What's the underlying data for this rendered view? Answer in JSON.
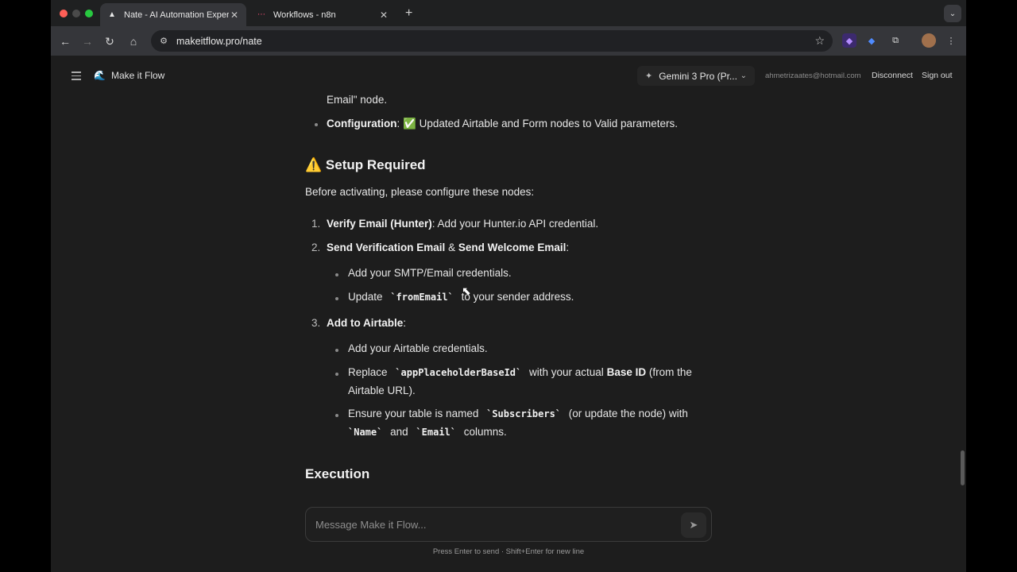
{
  "browser": {
    "tabs": [
      {
        "title": "Nate - AI Automation Expert",
        "active": true
      },
      {
        "title": "Workflows - n8n",
        "active": false
      }
    ],
    "url": "makeitflow.pro/nate"
  },
  "app": {
    "brand": "Make it Flow",
    "model_selector": "Gemini 3 Pro (Pr...",
    "user_email": "ahmetrizaates@hotmail.com",
    "disconnect_label": "Disconnect",
    "signout_label": "Sign out"
  },
  "message": {
    "line_email_node": "Email\" node.",
    "config_label": "Configuration",
    "config_colon": ":",
    "config_check": "✅",
    "config_text": "Updated Airtable and Form nodes to Valid parameters.",
    "setup_icon": "⚠️",
    "setup_heading": "Setup Required",
    "setup_intro": "Before activating, please configure these nodes:",
    "step1_num": "1.",
    "step1_bold": "Verify Email (Hunter)",
    "step1_text": ": Add your Hunter.io API credential.",
    "step2_num": "2.",
    "step2_bold_a": "Send Verification Email",
    "step2_amp": "&",
    "step2_bold_b": "Send Welcome Email",
    "step2_colon": ":",
    "step2_sub1": "Add your SMTP/Email credentials.",
    "step2_sub2_pre": "Update",
    "step2_sub2_code": "`fromEmail`",
    "step2_sub2_post": "to your sender address.",
    "step3_num": "3.",
    "step3_bold": "Add to Airtable",
    "step3_colon": ":",
    "step3_sub1": "Add your Airtable credentials.",
    "step3_sub2_pre": "Replace",
    "step3_sub2_code": "`appPlaceholderBaseId`",
    "step3_sub2_mid": "with your actual",
    "step3_sub2_bold": "Base ID",
    "step3_sub2_post": "(from the",
    "step3_sub2_line2": "Airtable URL).",
    "step3_sub3_pre": "Ensure your table is named",
    "step3_sub3_code": "`Subscribers`",
    "step3_sub3_post": "(or update the node) with",
    "step3_sub3_code2": "`Name`",
    "step3_sub3_and": "and",
    "step3_sub3_code3": "`Email`",
    "step3_sub3_end": "columns.",
    "execution_heading": "Execution"
  },
  "composer": {
    "placeholder": "Message Make it Flow...",
    "hint": "Press Enter to send · Shift+Enter for new line"
  }
}
